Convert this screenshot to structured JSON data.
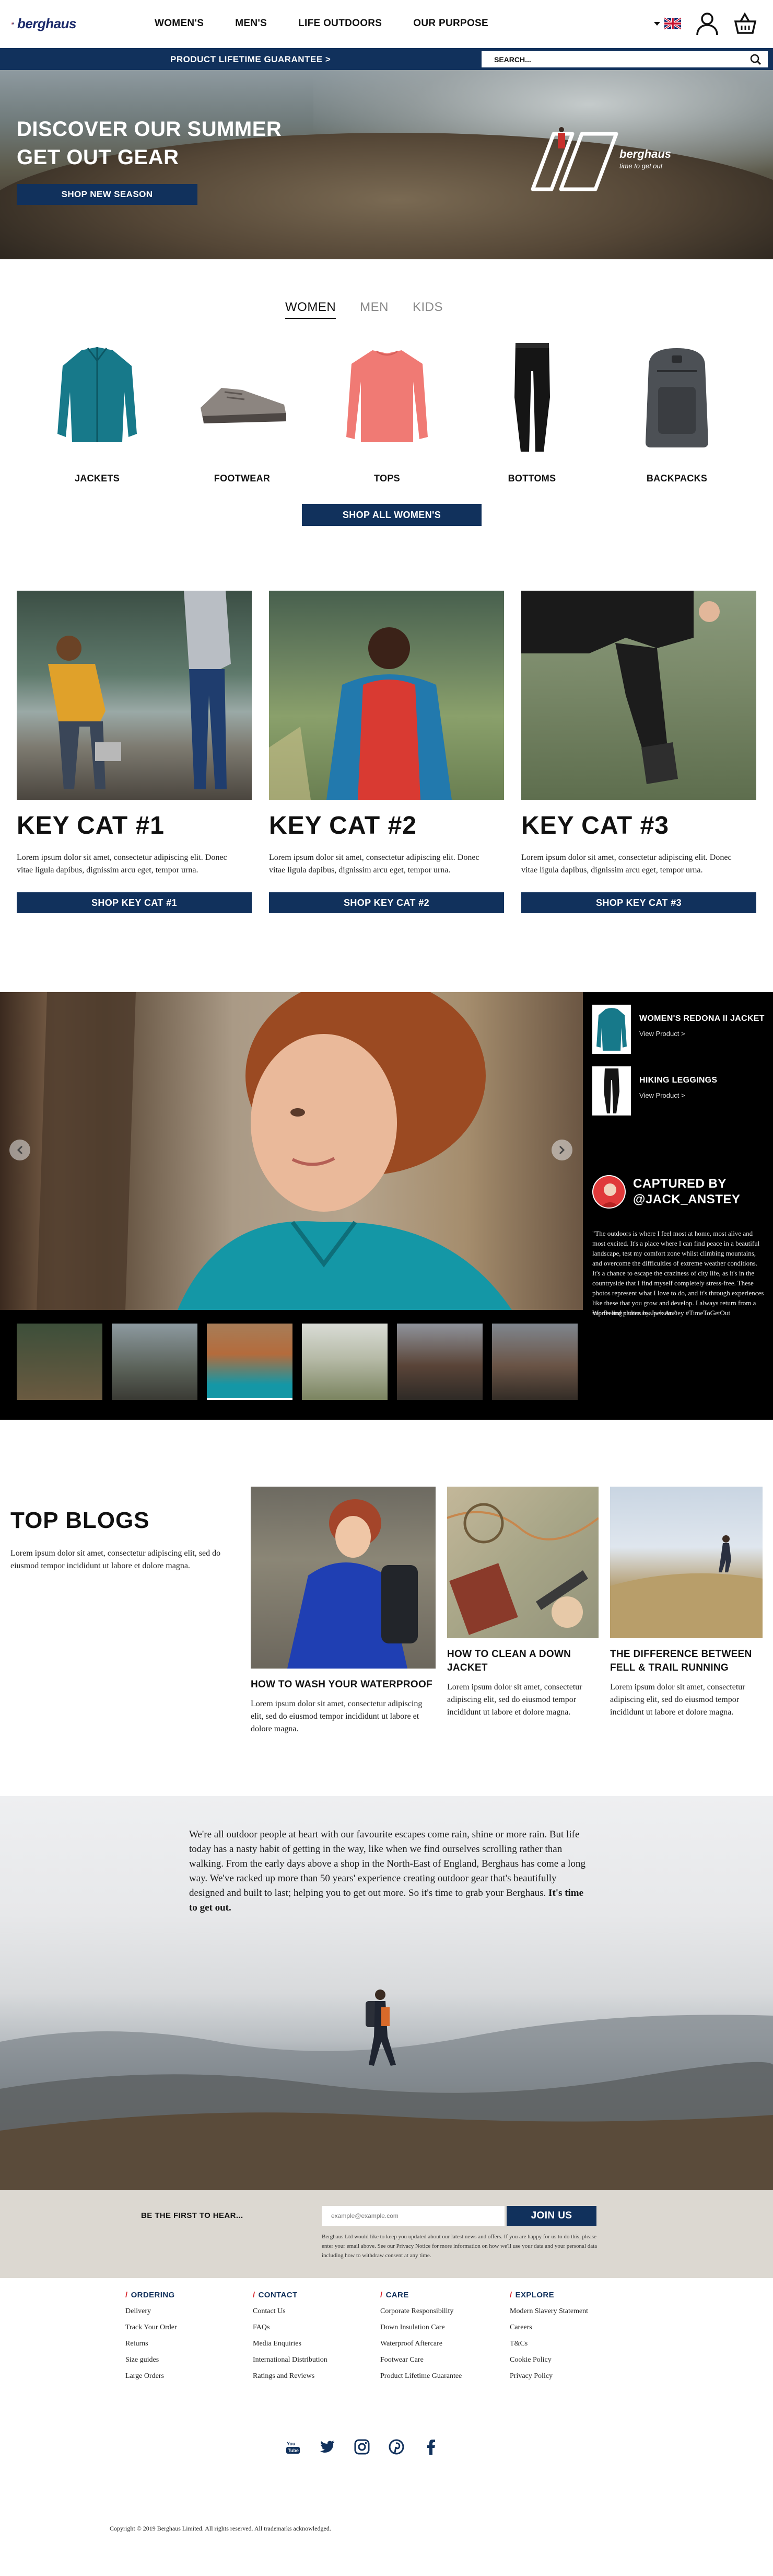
{
  "header": {
    "logo_text": "berghaus",
    "nav": [
      "WOMEN'S",
      "MEN'S",
      "LIFE OUTDOORS",
      "OUR PURPOSE"
    ],
    "icons": [
      "uk-flag-icon",
      "account-icon",
      "basket-icon"
    ]
  },
  "promo_bar": {
    "text": "PRODUCT LIFETIME GUARANTEE >",
    "search_placeholder": "SEARCH..."
  },
  "hero": {
    "title": "DISCOVER OUR SUMMER GET OUT GEAR",
    "button": "SHOP NEW SEASON",
    "badge_brand": "berghaus",
    "badge_tagline": "time to get out"
  },
  "categories": {
    "tabs": [
      "WOMEN",
      "MEN",
      "KIDS"
    ],
    "active_tab": "WOMEN",
    "products": [
      "JACKETS",
      "FOOTWEAR",
      "TOPS",
      "BOTTOMS",
      "BACKPACKS"
    ],
    "shop_all": "SHOP ALL WOMEN'S"
  },
  "key_cats": [
    {
      "title": "KEY CAT #1",
      "text": "Lorem ipsum dolor sit amet, consectetur adipiscing elit. Donec vitae ligula dapibus, dignissim arcu eget, tempor urna.",
      "button": "SHOP KEY CAT #1"
    },
    {
      "title": "KEY CAT #2",
      "text": "Lorem ipsum dolor sit amet, consectetur adipiscing elit. Donec vitae ligula dapibus, dignissim arcu eget, tempor urna.",
      "button": "SHOP KEY CAT #2"
    },
    {
      "title": "KEY CAT #3",
      "text": "Lorem ipsum dolor sit amet, consectetur adipiscing elit. Donec vitae ligula dapibus, dignissim arcu eget, tempor urna.",
      "button": "SHOP KEY CAT #3"
    }
  ],
  "gallery": {
    "products": [
      {
        "name": "WOMEN'S REDONA II JACKET",
        "link": "View Product >"
      },
      {
        "name": "HIKING LEGGINGS",
        "link": "View Product >"
      }
    ],
    "captured_title": "CAPTURED BY @JACK_ANSTEY",
    "quote": "\"The outdoors is where I feel most at home, most alive and most excited. It's a place where I can find peace in a beautiful landscape, test my comfort zone whilst climbing mountains, and overcome the difficulties of extreme weather conditions. It's a chance to escape the craziness of city life, as it's in the countryside that I find myself completely stress-free. These photos represent what I love to do, and it's through experiences like these that you grow and develop. I always return from a trip feeling richer as a person.\"",
    "credit": "Words and photos by Jack Anstey #TimeToGetOut"
  },
  "blogs": {
    "title": "TOP BLOGS",
    "intro": "Lorem ipsum dolor sit amet, consectetur adipiscing elit, sed do eiusmod tempor incididunt ut labore et dolore magna.",
    "items": [
      {
        "title": "HOW TO WASH YOUR WATERPROOF",
        "text": "Lorem ipsum dolor sit amet, consectetur adipiscing elit, sed do eiusmod tempor incididunt ut labore et dolore magna."
      },
      {
        "title": "HOW TO CLEAN A DOWN JACKET",
        "text": "Lorem ipsum dolor sit amet, consectetur adipiscing elit, sed do eiusmod tempor incididunt ut labore et dolore magna."
      },
      {
        "title": "THE DIFFERENCE BETWEEN FELL & TRAIL RUNNING",
        "text": "Lorem ipsum dolor sit amet, consectetur adipiscing elit, sed do eiusmod tempor incididunt ut labore et dolore magna."
      }
    ]
  },
  "story": {
    "text": "We're all outdoor people at heart with our favourite escapes come rain, shine or more rain. But life today has a nasty habit of getting in the way, like when we find ourselves scrolling rather than walking. From the early days above a shop in the North-East of England, Berghaus has come a long way. We've racked up more than 50 years' experience creating outdoor gear that's beautifully designed and built to last; helping you to get out more. So it's time to grab your Berghaus.",
    "emphasis": "It's time to get out."
  },
  "newsletter": {
    "label": "BE THE FIRST TO HEAR...",
    "placeholder": "example@example.com",
    "button": "JOIN US",
    "small_print": "Berghaus Ltd would like to keep you updated about our latest news and offers. If you are happy for us to do this, please enter your email above. See our Privacy Notice for more information on how we'll use your data and your personal data including how to withdraw consent at any time."
  },
  "footer": {
    "columns": [
      {
        "heading": "ORDERING",
        "links": [
          "Delivery",
          "Track Your Order",
          "Returns",
          "Size guides",
          "Large Orders"
        ]
      },
      {
        "heading": "CONTACT",
        "links": [
          "Contact Us",
          "FAQs",
          "Media Enquiries",
          "International Distribution",
          "Ratings and Reviews"
        ]
      },
      {
        "heading": "CARE",
        "links": [
          "Corporate Responsibility",
          "Down Insulation Care",
          "Waterproof Aftercare",
          "Footwear Care",
          "Product Lifetime Guarantee"
        ]
      },
      {
        "heading": "EXPLORE",
        "links": [
          "Modern Slavery Statement",
          "Careers",
          "T&Cs",
          "Cookie Policy",
          "Privacy Policy"
        ]
      }
    ],
    "socials": [
      "youtube-icon",
      "twitter-icon",
      "instagram-icon",
      "pinterest-icon",
      "facebook-icon"
    ],
    "copyright": "Copyright © 2019 Berghaus Limited. All rights reserved. All trademarks acknowledged."
  },
  "colors": {
    "navy": "#11315c",
    "accent_red": "#d81f26",
    "newsletter_bg": "#dcd8d1"
  }
}
